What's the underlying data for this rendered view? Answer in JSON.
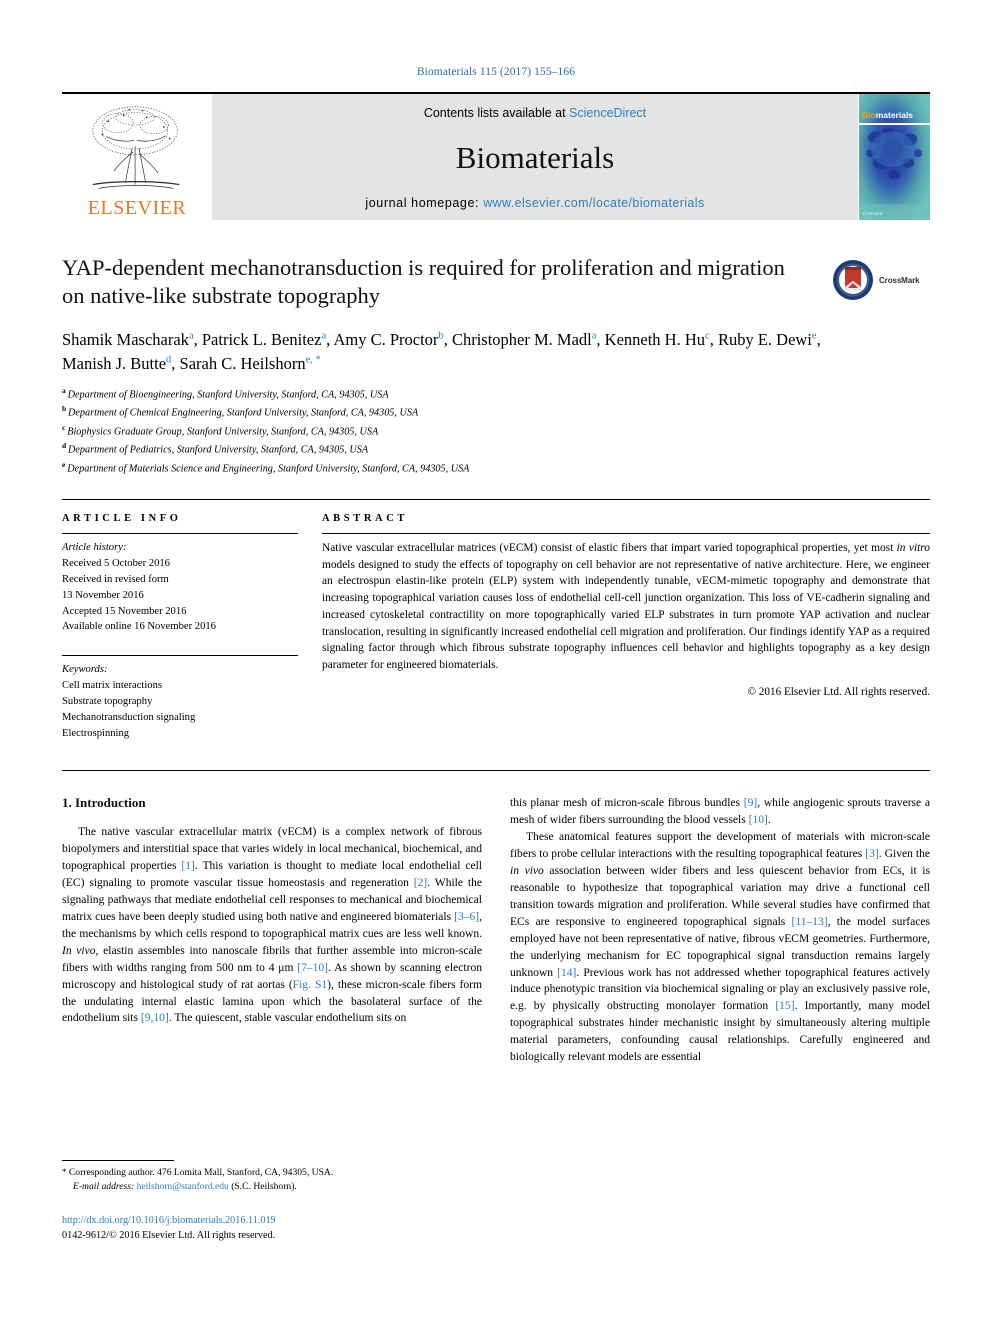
{
  "journal_ref": "Biomaterials 115 (2017) 155–166",
  "masthead": {
    "publisher": "ELSEVIER",
    "contents_prefix": "Contents lists available at ",
    "contents_link": "ScienceDirect",
    "journal_name": "Biomaterials",
    "homepage_prefix": "journal homepage: ",
    "homepage_url": "www.elsevier.com/locate/biomaterials",
    "cover_title_a": "Bio",
    "cover_title_b": "materials"
  },
  "article": {
    "title": "YAP-dependent mechanotransduction is required for proliferation and migration on native-like substrate topography",
    "crossmark_label": "CrossMark",
    "authors": [
      {
        "name": "Shamik Mascharak",
        "sup": "a",
        "sep": ", "
      },
      {
        "name": "Patrick L. Benitez",
        "sup": "a",
        "sep": ", "
      },
      {
        "name": "Amy C. Proctor",
        "sup": "b",
        "sep": ", "
      },
      {
        "name": "Christopher M. Madl",
        "sup": "a",
        "sep": ", "
      },
      {
        "name": "Kenneth H. Hu",
        "sup": "c",
        "sep": ", "
      },
      {
        "name": "Ruby E. Dewi",
        "sup": "e",
        "sep": ", "
      },
      {
        "name": "Manish J. Butte",
        "sup": "d",
        "sep": ", "
      },
      {
        "name": "Sarah C. Heilshorn",
        "sup": "e, *",
        "sep": ""
      }
    ],
    "affiliations": [
      {
        "marker": "a",
        "text": "Department of Bioengineering, Stanford University, Stanford, CA, 94305, USA"
      },
      {
        "marker": "b",
        "text": "Department of Chemical Engineering, Stanford University, Stanford, CA, 94305, USA"
      },
      {
        "marker": "c",
        "text": "Biophysics Graduate Group, Stanford University, Stanford, CA, 94305, USA"
      },
      {
        "marker": "d",
        "text": "Department of Pediatrics, Stanford University, Stanford, CA, 94305, USA"
      },
      {
        "marker": "e",
        "text": "Department of Materials Science and Engineering, Stanford University, Stanford, CA, 94305, USA"
      }
    ]
  },
  "article_info": {
    "label": "ARTICLE INFO",
    "history_title": "Article history:",
    "history": [
      "Received 5 October 2016",
      "Received in revised form",
      "13 November 2016",
      "Accepted 15 November 2016",
      "Available online 16 November 2016"
    ],
    "keywords_title": "Keywords:",
    "keywords": [
      "Cell matrix interactions",
      "Substrate topography",
      "Mechanotransduction signaling",
      "Electrospinning"
    ]
  },
  "abstract": {
    "label": "ABSTRACT",
    "part1": "Native vascular extracellular matrices (vECM) consist of elastic fibers that impart varied topographical properties, yet most ",
    "italic1": "in vitro",
    "part2": " models designed to study the effects of topography on cell behavior are not representative of native architecture. Here, we engineer an electrospun elastin-like protein (ELP) system with independently tunable, vECM-mimetic topography and demonstrate that increasing topographical variation causes loss of endothelial cell-cell junction organization. This loss of VE-cadherin signaling and increased cytoskeletal contractility on more topographically varied ELP substrates in turn promote YAP activation and nuclear translocation, resulting in significantly increased endothelial cell migration and proliferation. Our findings identify YAP as a required signaling factor through which fibrous substrate topography influences cell behavior and highlights topography as a key design parameter for engineered biomaterials.",
    "copyright": "© 2016 Elsevier Ltd. All rights reserved."
  },
  "body": {
    "section_heading": "1. Introduction",
    "left_para1": {
      "s1": "The native vascular extracellular matrix (vECM) is a complex network of fibrous biopolymers and interstitial space that varies widely in local mechanical, biochemical, and topographical properties ",
      "r1": "[1]",
      "s2": ". This variation is thought to mediate local endothelial cell (EC) signaling to promote vascular tissue homeostasis and regeneration ",
      "r2": "[2]",
      "s3": ". While the signaling pathways that mediate endothelial cell responses to mechanical and biochemical matrix cues have been deeply studied using both native and engineered biomaterials ",
      "r3": "[3–6]",
      "s4": ", the mechanisms by which cells respond to topographical matrix cues are less well known. ",
      "i1": "In vivo",
      "s5": ", elastin assembles into nanoscale fibrils that further assemble into micron-scale fibers with widths ranging from 500 nm to 4 μm ",
      "r4": "[7–10]",
      "s6": ". As shown by scanning electron microscopy and histological study of rat aortas (",
      "r5": "Fig. S1",
      "s7": "), these micron-scale fibers form the undulating internal elastic lamina upon which the basolateral surface of the endothelium sits ",
      "r6": "[9,10]",
      "s8": ". The quiescent, stable vascular endothelium sits on"
    },
    "right_para1": {
      "s1": "this planar mesh of micron-scale fibrous bundles ",
      "r1": "[9]",
      "s2": ", while angiogenic sprouts traverse a mesh of wider fibers surrounding the blood vessels ",
      "r2": "[10]",
      "s3": "."
    },
    "right_para2": {
      "s1": "These anatomical features support the development of materials with micron-scale fibers to probe cellular interactions with the resulting topographical features ",
      "r1": "[3]",
      "s2": ". Given the ",
      "i1": "in vivo",
      "s3": " association between wider fibers and less quiescent behavior from ECs, it is reasonable to hypothesize that topographical variation may drive a functional cell transition towards migration and proliferation. While several studies have confirmed that ECs are responsive to engineered topographical signals ",
      "r2": "[11–13]",
      "s4": ", the model surfaces employed have not been representative of native, fibrous vECM geometries. Furthermore, the underlying mechanism for EC topographical signal transduction remains largely unknown ",
      "r3": "[14]",
      "s5": ". Previous work has not addressed whether topographical features actively induce phenotypic transition via biochemical signaling or play an exclusively passive role, e.g. by physically obstructing monolayer formation ",
      "r4": "[15]",
      "s6": ". Importantly, many model topographical substrates hinder mechanistic insight by simultaneously altering multiple material parameters, confounding causal relationships. Carefully engineered and biologically relevant models are essential"
    }
  },
  "footnotes": {
    "star": "*",
    "corresponding": " Corresponding author. 476 Lomita Mall, Stanford, CA, 94305, USA.",
    "email_label": "E-mail address:",
    "email": "heilshorn@stanford.edu",
    "email_suffix": " (S.C. Heilshorn).",
    "doi": "http://dx.doi.org/10.1016/j.biomaterials.2016.11.019",
    "issn": "0142-9612/© 2016 Elsevier Ltd. All rights reserved."
  },
  "colors": {
    "link_blue": "#2e7dbd",
    "ref_blue": "#2e6ca4",
    "elsevier_orange": "#e87722",
    "band_gray": "#e4e4e4",
    "cover_teal": "#5fb3b0"
  }
}
